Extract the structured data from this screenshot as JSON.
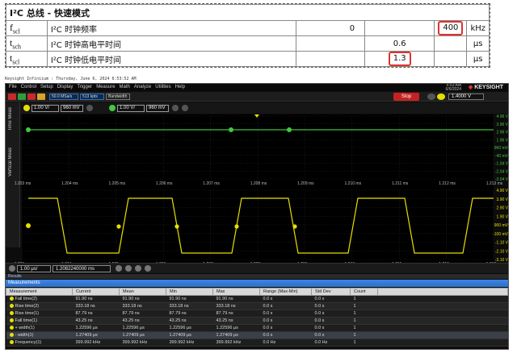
{
  "spec_table": {
    "title": "I²C 总线 - 快速模式",
    "rows": [
      {
        "symbol": "f",
        "sub": "scl",
        "name": "I²C 时钟频率",
        "min": "0",
        "typ": "",
        "max": "400",
        "unit": "kHz",
        "boxed": "max"
      },
      {
        "symbol": "t",
        "sub": "sch",
        "name": "I²C 时钟高电平时间",
        "min": "",
        "typ": "0.6",
        "max": "",
        "unit": "μs",
        "boxed": ""
      },
      {
        "symbol": "t",
        "sub": "scl",
        "name": "I²C 时钟低电平时间",
        "min": "",
        "typ": "1.3",
        "max": "",
        "unit": "μs",
        "boxed": "typ"
      }
    ]
  },
  "caption": "Keysight Infiniium : Thursday, June 6, 2024 6:53:52 AM",
  "scope": {
    "menu": [
      "File",
      "Control",
      "Setup",
      "Display",
      "Trigger",
      "Measure",
      "Math",
      "Analyze",
      "Utilities",
      "Help"
    ],
    "brand": "KEYSIGHT",
    "date_line1": "6:53 AM",
    "date_line2": "6/6/2024",
    "sample_rate": "50.0 MSa/s",
    "mem_depth": "513 kpts",
    "bandwidth_label": "Bandwidth",
    "run_state": "Stop",
    "trigger_level": "1.4000 V",
    "ch1_scale": "1.00 V/",
    "ch1_offset": "960 mV",
    "ch2_scale": "1.00 V/",
    "ch2_offset": "960 mV",
    "side_tabs": [
      "Time Meas",
      "Vertical Meas"
    ],
    "timebase": "1.00 μs/",
    "time_position": "1.2082240000 ms",
    "time_ticks": [
      "1.203 ms",
      "1.204 ms",
      "1.205 ms",
      "1.206 ms",
      "1.207 ms",
      "1.208 ms",
      "1.209 ms",
      "1.210 ms",
      "1.211 ms",
      "1.212 ms",
      "1.213 ms"
    ],
    "upper_volts": [
      "4.96 V",
      "3.96 V",
      "2.96 V",
      "1.96 V",
      "960 mV",
      "-40 mV",
      "-1.04 V",
      "-2.04 V",
      "-3.04 V"
    ],
    "lower_volts": [
      "4.90 V",
      "3.90 V",
      "2.90 V",
      "1.90 V",
      "900 mV",
      "-100 mV",
      "-1.10 V",
      "-2.10 V",
      "-3.10 V"
    ],
    "results_label": "Results",
    "measurements_label": "Measurements",
    "columns": [
      "Measurement",
      "Current",
      "Mean",
      "Min",
      "Max",
      "Range (Max-Min)",
      "Std Dev",
      "Count"
    ],
    "rows": [
      {
        "name": "Fall time(2)",
        "current": "91.90 ns",
        "mean": "91.90 ns",
        "min": "91.90 ns",
        "max": "91.90 ns",
        "range": "0.0 s",
        "std": "0.0 s",
        "count": "1",
        "color": "yellow"
      },
      {
        "name": "Rise time(2)",
        "current": "333.18 ns",
        "mean": "333.18 ns",
        "min": "333.18 ns",
        "max": "333.18 ns",
        "range": "0.0 s",
        "std": "0.0 s",
        "count": "1",
        "color": "yellow"
      },
      {
        "name": "Rise time(1)",
        "current": "87.79 ns",
        "mean": "87.79 ns",
        "min": "87.79 ns",
        "max": "87.79 ns",
        "range": "0.0 s",
        "std": "0.0 s",
        "count": "1",
        "color": "yellow"
      },
      {
        "name": "Fall time(1)",
        "current": "43.25 ns",
        "mean": "43.25 ns",
        "min": "43.25 ns",
        "max": "43.25 ns",
        "range": "0.0 s",
        "std": "0.0 s",
        "count": "1",
        "color": "yellow"
      },
      {
        "name": "+ width(1)",
        "current": "1.22596 μs",
        "mean": "1.22596 μs",
        "min": "1.22596 μs",
        "max": "1.22596 μs",
        "range": "0.0 s",
        "std": "0.0 s",
        "count": "1",
        "color": "yellow"
      },
      {
        "name": "- width(1)",
        "current": "1.27409 μs",
        "mean": "1.27409 μs",
        "min": "1.27409 μs",
        "max": "1.27409 μs",
        "range": "0.0 s",
        "std": "0.0 s",
        "count": "1",
        "color": "yellow"
      },
      {
        "name": "Frequency(1)",
        "current": "399.992 kHz",
        "mean": "399.992 kHz",
        "min": "399.992 kHz",
        "max": "399.992 kHz",
        "range": "0.0 Hz",
        "std": "0.0 Hz",
        "count": "1",
        "color": "yellow"
      }
    ]
  }
}
